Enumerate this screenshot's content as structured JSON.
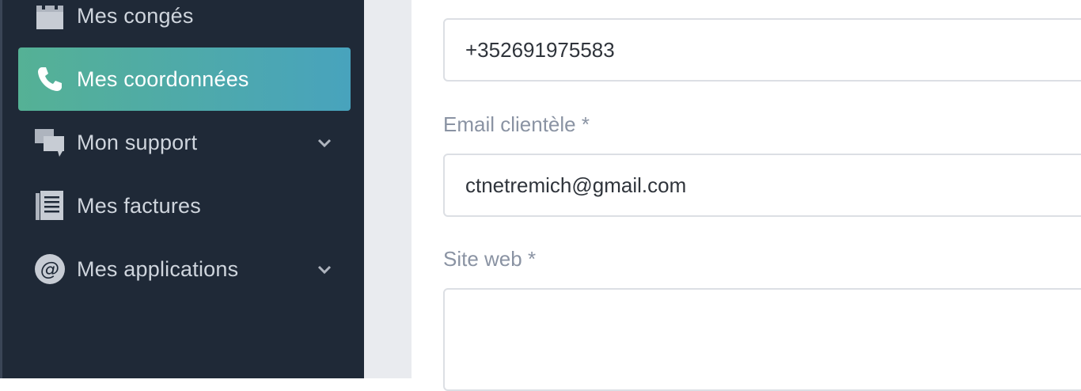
{
  "sidebar": {
    "items": [
      {
        "label": "Mes congés",
        "icon": "calendar-icon",
        "active": false
      },
      {
        "label": "Mes coordonnées",
        "icon": "phone-icon",
        "active": true
      },
      {
        "label": "Mon support",
        "icon": "chat-bubbles-icon",
        "has_submenu": true
      },
      {
        "label": "Mes factures",
        "icon": "invoice-document-icon"
      },
      {
        "label": "Mes applications",
        "icon": "at-sign-icon",
        "has_submenu": true
      }
    ]
  },
  "form": {
    "phone_value": "+352691975583",
    "email_label": "Email clientèle *",
    "email_value": "ctnetremich@gmail.com",
    "website_label": "Site web *",
    "website_value": ""
  },
  "colors": {
    "sidebar_bg": "#1f2937",
    "active_gradient_start": "#55b195",
    "active_gradient_end": "#48a3bd",
    "label_gray": "#8a93a3"
  }
}
